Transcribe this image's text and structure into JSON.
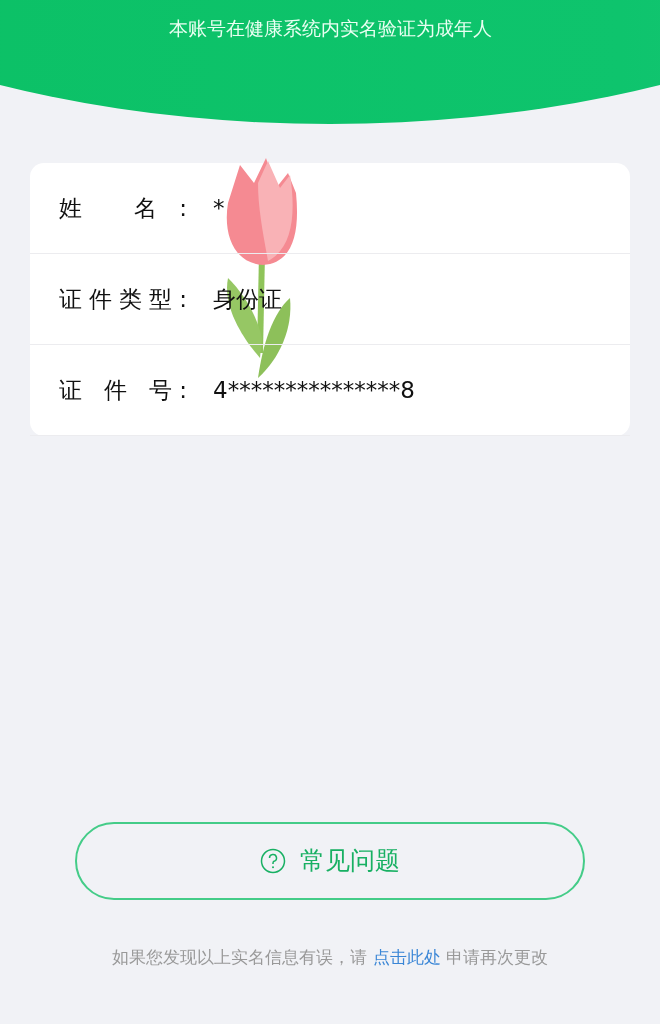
{
  "header": {
    "subtitle": "本账号在健康系统内实名验证为成年人"
  },
  "fields": [
    {
      "label": "姓 名:",
      "value": "*"
    },
    {
      "label": "证件类型:",
      "value": "身份证"
    },
    {
      "label": "证 件 号:",
      "value": "4***************8"
    }
  ],
  "faq_button": {
    "label": "常见问题"
  },
  "footer": {
    "before": "如果您发现以上实名信息有误，请",
    "link": "点击此处",
    "after": "申请再次更改"
  }
}
